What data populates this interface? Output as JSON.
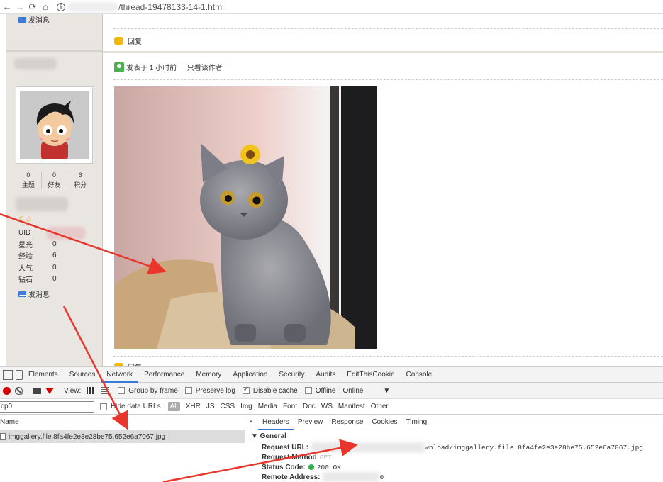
{
  "browser": {
    "url_suffix": "/thread-19478133-14-1.html"
  },
  "sidebar": {
    "send_message_label": "发消息",
    "stats": [
      {
        "value": "0",
        "label": "主题"
      },
      {
        "value": "0",
        "label": "好友"
      },
      {
        "value": "6",
        "label": "积分"
      }
    ],
    "info": [
      {
        "key": "UID",
        "value": ""
      },
      {
        "key": "星光",
        "value": "0"
      },
      {
        "key": "经验",
        "value": "6"
      },
      {
        "key": "人气",
        "value": "0"
      },
      {
        "key": "钻石",
        "value": "0"
      }
    ]
  },
  "post": {
    "reply_label": "回复",
    "posted_at": "发表于 1 小时前",
    "author_only": "只看该作者",
    "separator": "|"
  },
  "devtools": {
    "tabs": [
      "Elements",
      "Sources",
      "Network",
      "Performance",
      "Memory",
      "Application",
      "Security",
      "Audits",
      "EditThisCookie",
      "Console"
    ],
    "active_tab": "Network",
    "toolbar": {
      "view_label": "View:",
      "group_by_frame": "Group by frame",
      "preserve_log": "Preserve log",
      "disable_cache": "Disable cache",
      "offline": "Offline",
      "online": "Online"
    },
    "filter": {
      "value": "cp0",
      "hide_data_urls": "Hide data URLs",
      "types": [
        "All",
        "XHR",
        "JS",
        "CSS",
        "Img",
        "Media",
        "Font",
        "Doc",
        "WS",
        "Manifest",
        "Other"
      ]
    },
    "list": {
      "header": "Name",
      "rows": [
        "imggallery.file.8fa4fe2e3e28be75.652e6a7067.jpg"
      ]
    },
    "detail": {
      "close": "×",
      "tabs": [
        "Headers",
        "Preview",
        "Response",
        "Cookies",
        "Timing"
      ],
      "section": "▼ General",
      "request_url_label": "Request URL:",
      "request_url_tail": "wnload/imggallery.file.8fa4fe2e3e28be75.652e6a7067.jpg",
      "request_method_label": "Request Method",
      "request_method_value": "GET",
      "status_label": "Status Code:",
      "status_value": "200 OK",
      "remote_label": "Remote Address:",
      "remote_tail": "0"
    }
  },
  "colors": {
    "annotation_arrow": "#e8362c",
    "devtools_accent": "#3879d9"
  }
}
